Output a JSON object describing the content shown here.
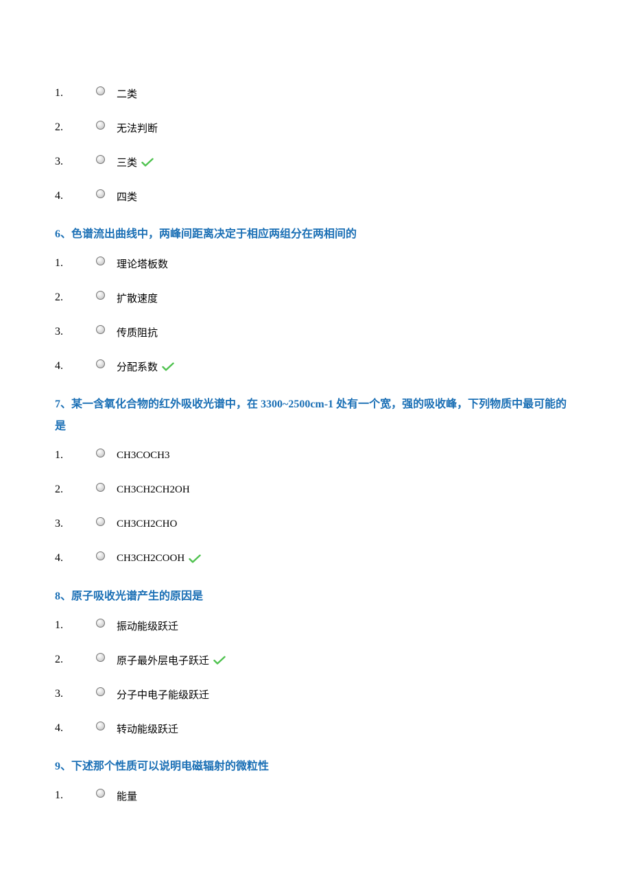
{
  "questions": [
    {
      "title": "",
      "options": [
        {
          "num": "1.",
          "text": "二类",
          "correct": false
        },
        {
          "num": "2.",
          "text": "无法判断",
          "correct": false
        },
        {
          "num": "3.",
          "text": "三类",
          "correct": true
        },
        {
          "num": "4.",
          "text": "四类",
          "correct": false
        }
      ]
    },
    {
      "title": "6、色谱流出曲线中，两峰间距离决定于相应两组分在两相间的",
      "options": [
        {
          "num": "1.",
          "text": "理论塔板数",
          "correct": false
        },
        {
          "num": "2.",
          "text": "扩散速度",
          "correct": false
        },
        {
          "num": "3.",
          "text": "传质阻抗",
          "correct": false
        },
        {
          "num": "4.",
          "text": "分配系数",
          "correct": true
        }
      ]
    },
    {
      "title": "7、某一含氧化合物的红外吸收光谱中，在 3300~2500cm-1 处有一个宽，强的吸收峰，下列物质中最可能的是",
      "options": [
        {
          "num": "1.",
          "text": "CH3COCH3",
          "correct": false
        },
        {
          "num": "2.",
          "text": "CH3CH2CH2OH",
          "correct": false
        },
        {
          "num": "3.",
          "text": "CH3CH2CHO",
          "correct": false
        },
        {
          "num": "4.",
          "text": "CH3CH2COOH",
          "correct": true
        }
      ]
    },
    {
      "title": "8、原子吸收光谱产生的原因是",
      "options": [
        {
          "num": "1.",
          "text": "振动能级跃迁",
          "correct": false
        },
        {
          "num": "2.",
          "text": "原子最外层电子跃迁",
          "correct": true
        },
        {
          "num": "3.",
          "text": "分子中电子能级跃迁",
          "correct": false
        },
        {
          "num": "4.",
          "text": "转动能级跃迁",
          "correct": false
        }
      ]
    },
    {
      "title": "9、下述那个性质可以说明电磁辐射的微粒性",
      "options": [
        {
          "num": "1.",
          "text": "能量",
          "correct": false
        }
      ]
    }
  ]
}
